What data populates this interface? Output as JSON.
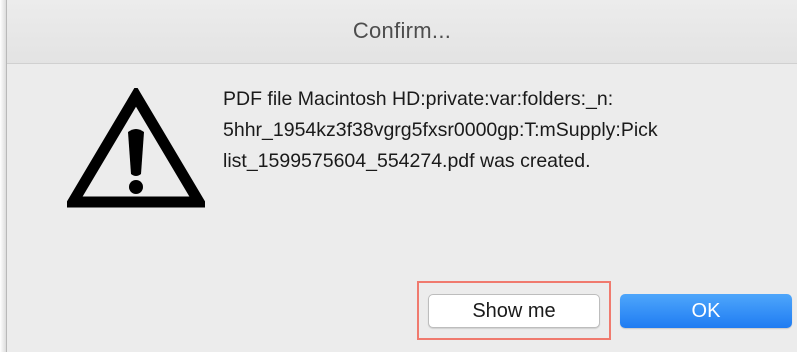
{
  "dialog": {
    "title": "Confirm...",
    "icon": "warning-icon",
    "message_lines": [
      "PDF file Macintosh HD:private:var:folders:_n:",
      "5hhr_1954kz3f38vgrg5fxsr0000gp:T:mSupply:Pick",
      "list_1599575604_554274.pdf was created."
    ],
    "buttons": {
      "show_me": "Show me",
      "ok": "OK"
    },
    "colors": {
      "accent": "#1f7cf2",
      "highlight": "#f07a6e",
      "background": "#ececec"
    }
  }
}
